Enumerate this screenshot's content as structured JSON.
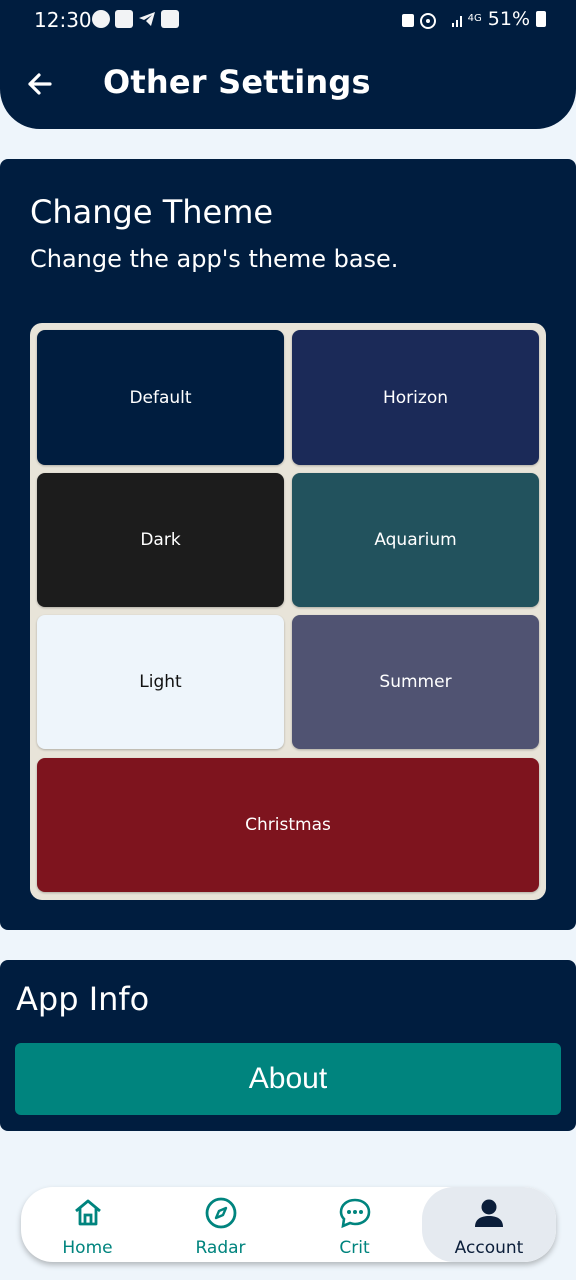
{
  "status_bar": {
    "time": "12:30",
    "battery": "51%",
    "network": "4G"
  },
  "header": {
    "title": "Other Settings"
  },
  "theme_section": {
    "title": "Change Theme",
    "subtitle": "Change the app's theme base.",
    "themes": [
      {
        "label": "Default",
        "color": "#001D3F"
      },
      {
        "label": "Horizon",
        "color": "#1B2A58"
      },
      {
        "label": "Dark",
        "color": "#1C1C1C"
      },
      {
        "label": "Aquarium",
        "color": "#22525D"
      },
      {
        "label": "Light",
        "color": "#EEF5FB"
      },
      {
        "label": "Summer",
        "color": "#505372"
      },
      {
        "label": "Christmas",
        "color": "#7E141E"
      }
    ]
  },
  "app_info": {
    "title": "App Info",
    "about_label": "About"
  },
  "bottom_nav": {
    "items": [
      {
        "label": "Home",
        "icon": "home-icon"
      },
      {
        "label": "Radar",
        "icon": "compass-icon"
      },
      {
        "label": "Crit",
        "icon": "chat-bubble-icon"
      },
      {
        "label": "Account",
        "icon": "person-icon",
        "selected": true
      }
    ]
  },
  "colors": {
    "primary": "#001D3F",
    "accent": "#00847E",
    "background": "#EEF5FB"
  }
}
